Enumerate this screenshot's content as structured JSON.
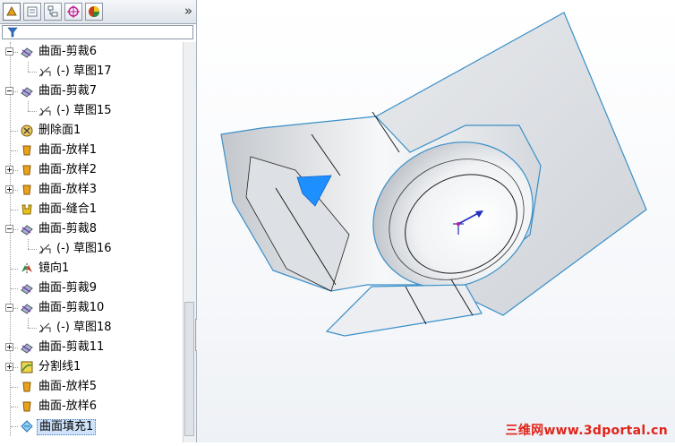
{
  "tabs": [
    {
      "name": "feature-manager-tab-icon",
      "color": "#e2a21b"
    },
    {
      "name": "property-manager-tab-icon",
      "color": "#6b7c8f"
    },
    {
      "name": "configuration-manager-tab-icon",
      "color": "#5a6b7a"
    },
    {
      "name": "dimxpert-tab-icon",
      "color": "#c2188f"
    },
    {
      "name": "display-manager-tab-icon",
      "color": "#c23b1b"
    }
  ],
  "more_glyph": "»",
  "tree": {
    "items": [
      {
        "label": "曲面-剪裁6",
        "level": 0,
        "expander": "minus",
        "icon": "surface-trim-icon"
      },
      {
        "label": "(-) 草图17",
        "level": 1,
        "expander": "none",
        "icon": "sketch-icon"
      },
      {
        "label": "曲面-剪裁7",
        "level": 0,
        "expander": "minus",
        "icon": "surface-trim-icon"
      },
      {
        "label": "(-) 草图15",
        "level": 1,
        "expander": "none",
        "icon": "sketch-icon"
      },
      {
        "label": "删除面1",
        "level": 0,
        "expander": "none",
        "icon": "delete-face-icon"
      },
      {
        "label": "曲面-放样1",
        "level": 0,
        "expander": "none",
        "icon": "surface-loft-icon"
      },
      {
        "label": "曲面-放样2",
        "level": 0,
        "expander": "plus",
        "icon": "surface-loft-icon"
      },
      {
        "label": "曲面-放样3",
        "level": 0,
        "expander": "plus",
        "icon": "surface-loft-icon"
      },
      {
        "label": "曲面-缝合1",
        "level": 0,
        "expander": "none",
        "icon": "surface-knit-icon"
      },
      {
        "label": "曲面-剪裁8",
        "level": 0,
        "expander": "minus",
        "icon": "surface-trim-icon"
      },
      {
        "label": "(-) 草图16",
        "level": 1,
        "expander": "none",
        "icon": "sketch-icon"
      },
      {
        "label": "镜向1",
        "level": 0,
        "expander": "none",
        "icon": "mirror-icon"
      },
      {
        "label": "曲面-剪裁9",
        "level": 0,
        "expander": "none",
        "icon": "surface-trim-icon"
      },
      {
        "label": "曲面-剪裁10",
        "level": 0,
        "expander": "minus",
        "icon": "surface-trim-icon"
      },
      {
        "label": "(-) 草图18",
        "level": 1,
        "expander": "none",
        "icon": "sketch-icon"
      },
      {
        "label": "曲面-剪裁11",
        "level": 0,
        "expander": "plus",
        "icon": "surface-trim-icon"
      },
      {
        "label": "分割线1",
        "level": 0,
        "expander": "plus",
        "icon": "split-line-icon"
      },
      {
        "label": "曲面-放样5",
        "level": 0,
        "expander": "none",
        "icon": "surface-loft-icon"
      },
      {
        "label": "曲面-放样6",
        "level": 0,
        "expander": "none",
        "icon": "surface-loft-icon"
      },
      {
        "label": "曲面填充1",
        "level": 0,
        "expander": "none",
        "icon": "surface-fill-icon",
        "selected": true
      }
    ]
  },
  "watermark": "三维网www.3dportal.cn",
  "colors": {
    "selection": "#1e8fff",
    "surface_edge": "#3a8fc8",
    "triad": "#1f2fbf"
  }
}
